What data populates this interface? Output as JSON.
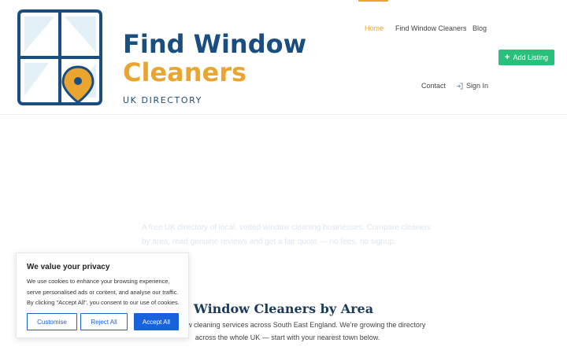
{
  "colors": {
    "brand_blue": "#1a4e80",
    "brand_orange": "#e9a530",
    "green": "#28c07a",
    "cookie_blue": "#1863dc"
  },
  "logo": {
    "line1": "Find Window",
    "line2": "Cleaners",
    "subtitle": "UK DIRECTORY",
    "icon": "window-pin-icon"
  },
  "nav": {
    "home": "Home",
    "find": "Find Window Cleaners",
    "blog": "Blog",
    "contact": "Contact",
    "signin": "Sign In",
    "add_listing": "Add Listing"
  },
  "hero": {
    "text_a": "A free UK directory of local, vetted window cleaning businesses. Compare cleaners by area, read genuine reviews and get a fair quote — no fees, no signup."
  },
  "section": {
    "title": "Window Cleaners by Area",
    "desc": "Local window cleaning services across South East England. We're growing the directory across the whole UK — start with your nearest town below."
  },
  "cookie": {
    "title": "We value your privacy",
    "text": "We use cookies to enhance your browsing experience, serve personalised ads or content, and analyse our traffic. By clicking \"Accept All\", you consent to our use of cookies.",
    "customise": "Customise",
    "reject": "Reject All",
    "accept": "Accept All"
  }
}
